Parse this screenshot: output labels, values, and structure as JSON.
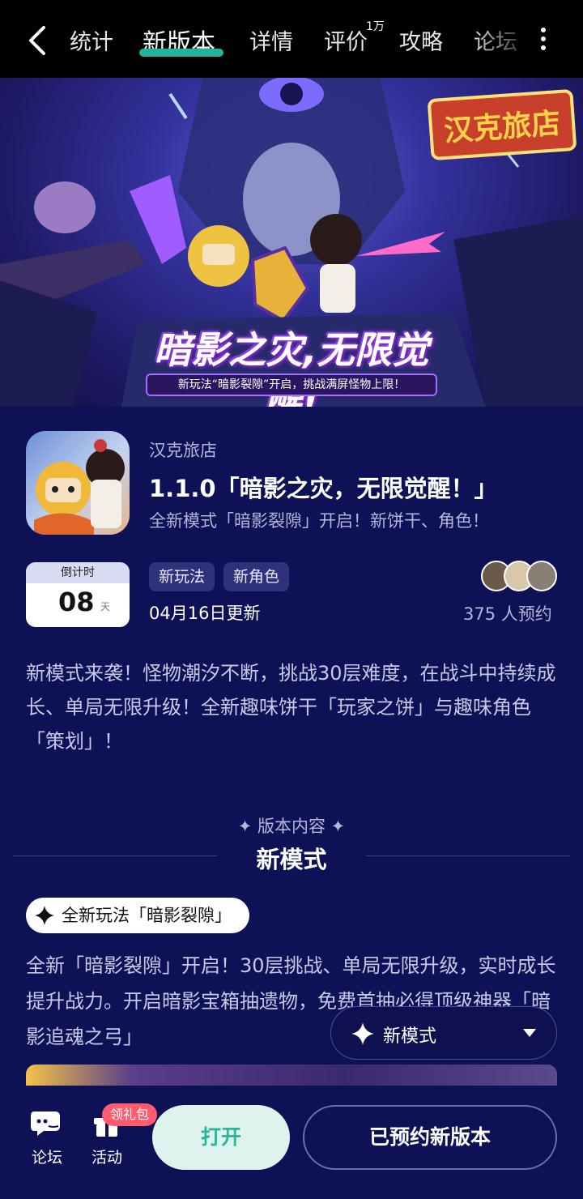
{
  "nav": {
    "tabs": [
      {
        "label": "统计"
      },
      {
        "label": "新版本"
      },
      {
        "label": "详情"
      },
      {
        "label": "评价",
        "badge": "1万"
      },
      {
        "label": "攻略"
      },
      {
        "label": "论坛"
      }
    ],
    "active_tab": "新版本"
  },
  "banner": {
    "logo_text": "汉克旅店",
    "title": "暗影之灾,无限觉醒!",
    "subtitle": "新玩法“暗影裂隙”开启，挑战满屏怪物上限！"
  },
  "version": {
    "game_name": "汉克旅店",
    "title": "1.1.0「暗影之灾，无限觉醒！」",
    "subtitle": "全新模式「暗影裂隙」开启！新饼干、角色！",
    "countdown_label": "倒计时",
    "countdown_value": "08",
    "countdown_unit": "天",
    "tags": [
      "新玩法",
      "新角色"
    ],
    "update_date": "04月16日更新",
    "reserve_count": "375 人预约",
    "description": "新模式来袭！怪物潮汐不断，挑战30层难度，在战斗中持续成长、单局无限升级！全新趣味饼干「玩家之饼」与趣味角色「策划」！"
  },
  "content": {
    "kicker": "✦ 版本内容 ✦",
    "section_title": "新模式",
    "feature_label": "全新玩法「暗影裂隙」",
    "feature_text": "全新「暗影裂隙」开启！30层挑战、单局无限升级，实时成长提升战力。开启暗影宝箱抽遗物，免费首抽必得顶级神器「暗影追魂之弓」"
  },
  "dropdown": {
    "label": "新模式"
  },
  "bottom": {
    "forum_label": "论坛",
    "activity_label": "活动",
    "gift_badge": "领礼包",
    "open_button": "打开",
    "reserved_button": "已预约新版本"
  },
  "colors": {
    "background": "#0f1157",
    "accent": "#24b39c",
    "gift_badge": "#ff5c6f"
  }
}
